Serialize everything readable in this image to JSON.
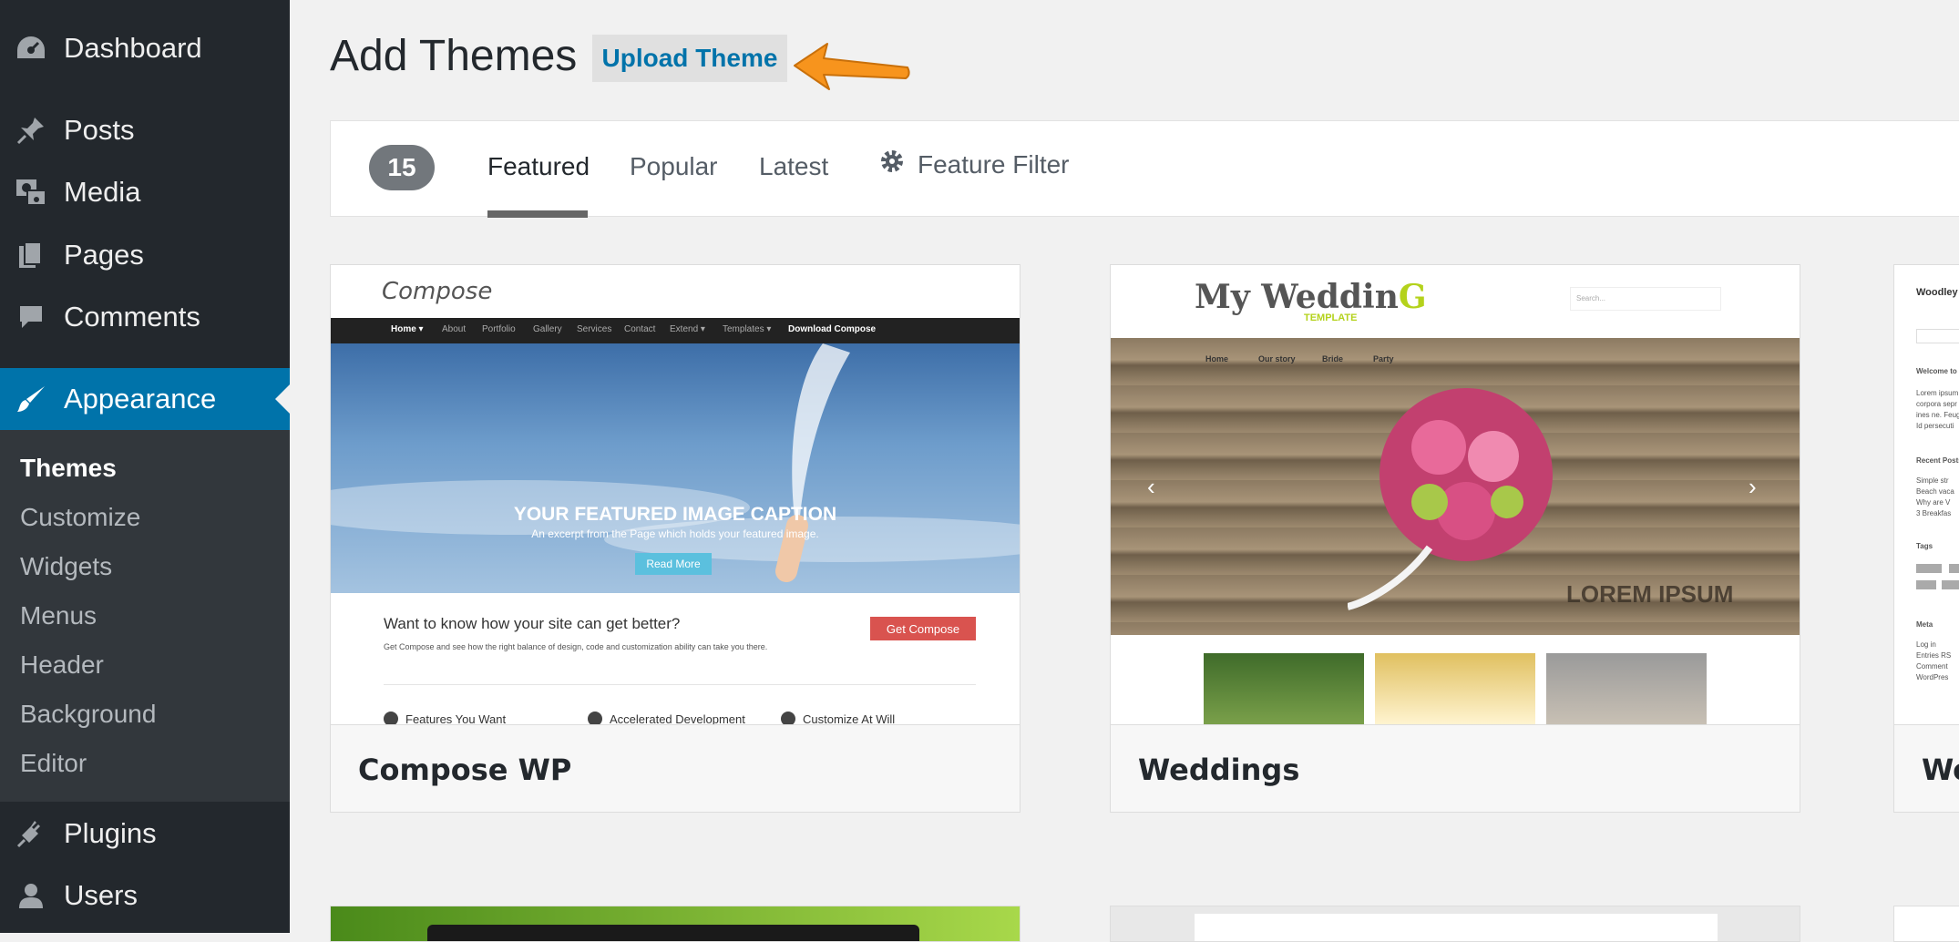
{
  "sidebar": {
    "items": [
      {
        "label": "Dashboard",
        "icon": "dashboard-icon"
      },
      {
        "label": "Posts",
        "icon": "pin-icon"
      },
      {
        "label": "Media",
        "icon": "media-icon"
      },
      {
        "label": "Pages",
        "icon": "pages-icon"
      },
      {
        "label": "Comments",
        "icon": "comment-icon"
      },
      {
        "label": "Appearance",
        "icon": "brush-icon"
      },
      {
        "label": "Plugins",
        "icon": "plug-icon"
      },
      {
        "label": "Users",
        "icon": "user-icon"
      }
    ],
    "submenu": [
      "Themes",
      "Customize",
      "Widgets",
      "Menus",
      "Header",
      "Background",
      "Editor"
    ],
    "active_color": "#0073aa"
  },
  "header": {
    "title": "Add Themes",
    "upload_label": "Upload Theme",
    "annotation_color": "#f7941d"
  },
  "filter": {
    "count": "15",
    "tabs": [
      "Featured",
      "Popular",
      "Latest"
    ],
    "feature_filter": "Feature Filter"
  },
  "themes": [
    {
      "name": "Compose WP",
      "preview": {
        "logo": "Compose",
        "nav": [
          "Home ▾",
          "About",
          "Portfolio",
          "Gallery",
          "Services",
          "Contact",
          "Extend ▾",
          "Templates ▾",
          "Download Compose"
        ],
        "caption": "YOUR FEATURED IMAGE CAPTION",
        "caption_sub": "An excerpt from the Page which holds your featured image.",
        "read_more": "Read More",
        "cta": "Want to know how your site can get better?",
        "cta_sub": "Get Compose and see how the right balance of design, code and customization ability can take you there.",
        "get_button": "Get Compose",
        "features": [
          "Features You Want",
          "Accelerated Development",
          "Customize At Will"
        ]
      }
    },
    {
      "name": "Weddings",
      "preview": {
        "logo_main": "My Weddin",
        "logo_accent": "G",
        "logo_sub": "TEMPLATE",
        "search": "Search...",
        "menu": [
          "Home",
          "Our story",
          "Bride",
          "Party"
        ],
        "overlay": "LOREM IPSUM"
      }
    },
    {
      "name": "Wo",
      "preview": {
        "title": "Woodley",
        "lines": [
          "Welcome to",
          "Lorem ipsum",
          "corpora sepr",
          "ines ne. Feug",
          "Id persecuti",
          "Recent Posts",
          "Simple str",
          "Beach vaca",
          "Why are V",
          "3 Breakfas",
          "Tags",
          "Meta",
          "Log in",
          "Entries RS",
          "Comment",
          "WordPres"
        ]
      }
    }
  ]
}
